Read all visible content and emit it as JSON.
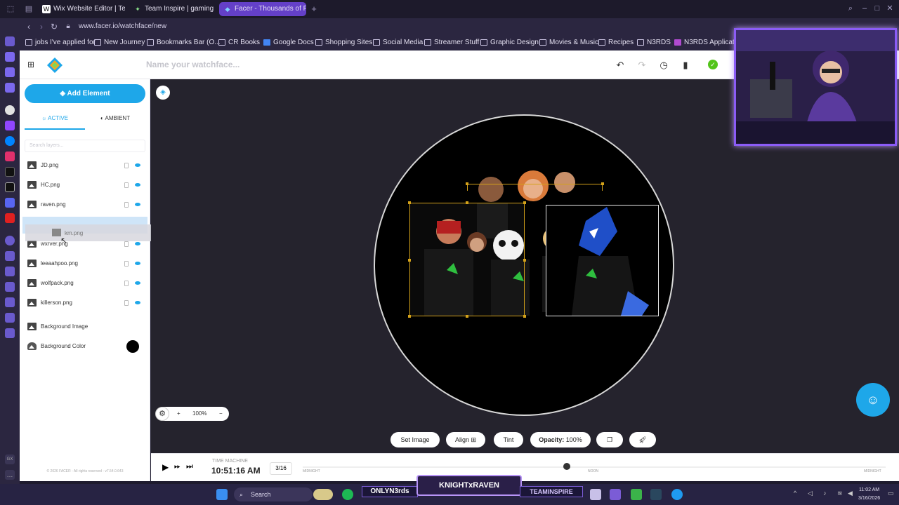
{
  "browser": {
    "tabs": [
      {
        "label": "Wix Website Editor | Team",
        "active": false
      },
      {
        "label": "Team Inspire | gaming",
        "active": false
      },
      {
        "label": "Facer - Thousands of FRE",
        "active": true
      }
    ],
    "new_tab": "+",
    "url": "www.facer.io/watchface/new",
    "bookmarks": [
      "jobs I've applied for",
      "New Journey",
      "Bookmarks Bar (O...",
      "CR Books",
      "Google Docs",
      "Shopping Sites",
      "Social Media",
      "Streamer Stuff",
      "Graphic Design",
      "Movies & Music",
      "Recipes",
      "N3RDS",
      "N3RDS Applicati"
    ]
  },
  "app": {
    "name_placeholder": "Name your watchface...",
    "add_element": "Add Element",
    "mode_tabs": [
      "ACTIVE",
      "AMBIENT"
    ],
    "search_placeholder": "Search layers...",
    "layers": [
      "JD.png",
      "HC.png",
      "raven.png",
      "wxrver.png",
      "leeaahpoo.png",
      "wolfpack.png",
      "killerson.png"
    ],
    "dragging_layer": "km.png",
    "background_image": "Background Image",
    "background_color": "Background Color",
    "bg_color_value": "#000000",
    "zoom": "100%",
    "toolbar": {
      "set_image": "Set Image",
      "align": "Align",
      "tint": "Tint",
      "opacity_label": "Opacity:",
      "opacity_value": "100%"
    },
    "time_machine": {
      "label": "TIME MACHINE",
      "time": "10:51:16 AM",
      "date": "3/16",
      "left_label": "MIDNIGHT",
      "mid_label": "NOON",
      "right_label": "MIDNIGHT"
    },
    "copyright": "© 2026 FACER - All rights reserved - v7.54.0.643",
    "accent": "#1ea7e9"
  },
  "taskbar": {
    "search": "Search",
    "time": "11:02 AM",
    "date": "3/16/2026",
    "banner": "KNIGHTxRAVEN",
    "banner_left": "ONLYN3rds",
    "banner_right": "TEAMINSPIRE"
  }
}
